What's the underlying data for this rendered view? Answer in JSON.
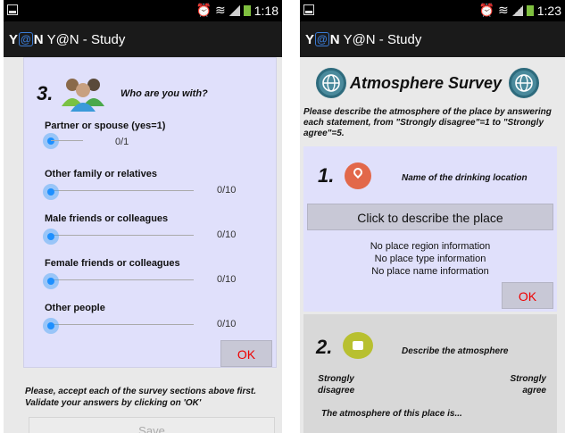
{
  "left": {
    "status": {
      "time": "1:18"
    },
    "appbar": {
      "logo": {
        "y": "Y",
        "at": "@",
        "n": "N"
      },
      "title": "Y@N - Study"
    },
    "question": {
      "number": "3.",
      "title": "Who are you with?",
      "rows": [
        {
          "label": "Partner or spouse (yes=1)",
          "value": "0/1"
        },
        {
          "label": "Other family or relatives",
          "value": "0/10"
        },
        {
          "label": "Male friends or colleagues",
          "value": "0/10"
        },
        {
          "label": "Female friends or colleagues",
          "value": "0/10"
        },
        {
          "label": "Other people",
          "value": "0/10"
        }
      ],
      "ok": "OK"
    },
    "hint": "Please, accept each of the survey sections above first. Validate your answers by clicking on 'OK'",
    "save": "Save"
  },
  "right": {
    "status": {
      "time": "1:23"
    },
    "appbar": {
      "logo": {
        "y": "Y",
        "at": "@",
        "n": "N"
      },
      "title": "Y@N - Study"
    },
    "survey_title": "Atmosphere Survey",
    "intro": "Please describe the atmosphere of the place by answering each statement, from \"Strongly disagree\"=1 to \"Strongly agree\"=5.",
    "q1": {
      "number": "1.",
      "title": "Name of the drinking location",
      "describe_button": "Click to describe the place",
      "info": [
        "No place region information",
        "No place type information",
        "No place name information"
      ],
      "ok": "OK"
    },
    "q2": {
      "number": "2.",
      "title": "Describe the atmosphere",
      "scale_left": [
        "Strongly",
        "disagree"
      ],
      "scale_right": [
        "Strongly",
        "agree"
      ],
      "statement": "The atmosphere of this place is..."
    }
  },
  "colors": {
    "card": "#e0e0fb",
    "ok_text": "#e00000",
    "slider": "#1e90ff",
    "appbar": "#1a1a1a"
  }
}
